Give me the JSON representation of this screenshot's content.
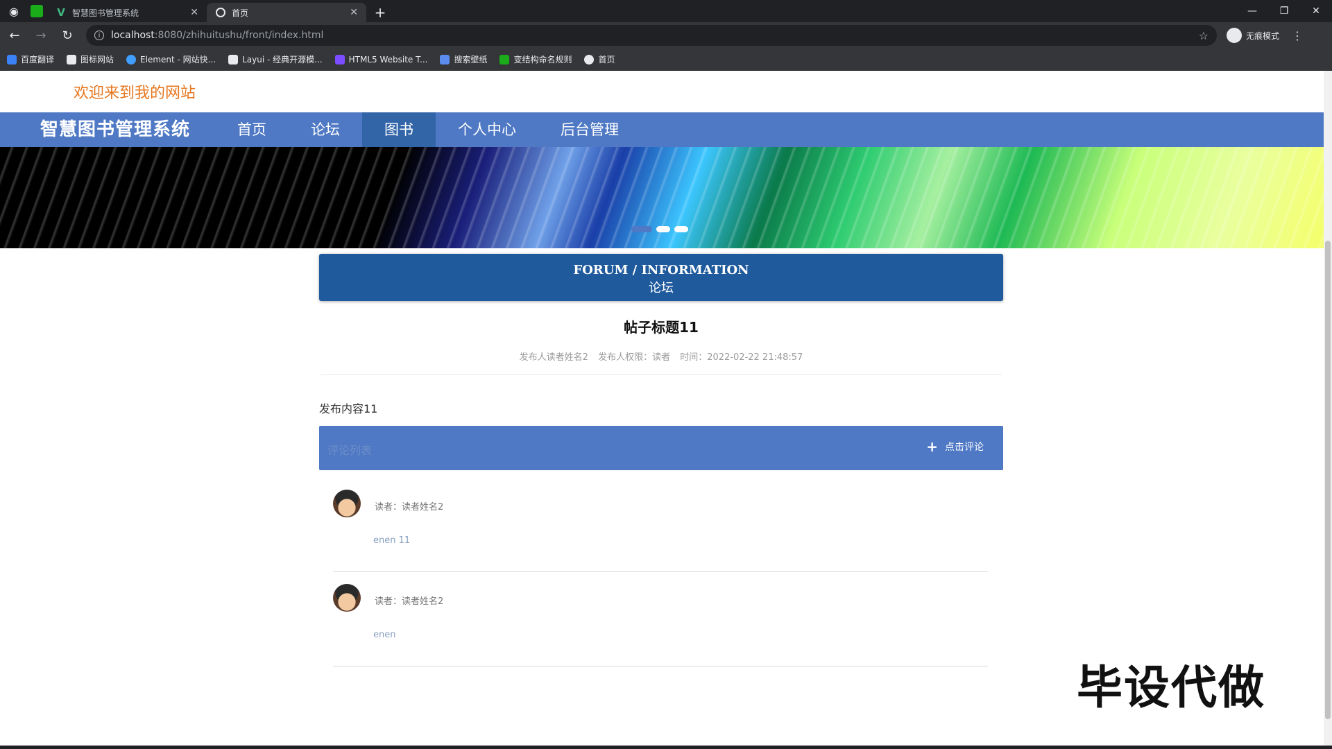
{
  "browser": {
    "tabs": [
      {
        "title": "智慧图书管理系统",
        "active": false
      },
      {
        "title": "首页",
        "active": true
      }
    ],
    "url_host": "localhost",
    "url_path": ":8080/zhihuitushu/front/index.html",
    "incognito_label": "无痕模式",
    "bookmarks": [
      {
        "label": "百度翻译",
        "color": "#3b82f6"
      },
      {
        "label": "图标网站",
        "color": "#e8eaed"
      },
      {
        "label": "Element - 网站快...",
        "color": "#409eff"
      },
      {
        "label": "Layui - 经典开源模...",
        "color": "#e8eaed"
      },
      {
        "label": "HTML5 Website T...",
        "color": "#7c4dff"
      },
      {
        "label": "搜索壁纸",
        "color": "#5b8def"
      },
      {
        "label": "变结构命名规则",
        "color": "#1aad19"
      },
      {
        "label": "首页",
        "color": "#e8eaed"
      }
    ]
  },
  "site": {
    "welcome": "欢迎来到我的网站",
    "brand": "智慧图书管理系统",
    "menu": [
      "首页",
      "论坛",
      "图书",
      "个人中心",
      "后台管理"
    ],
    "active_menu_index": 2
  },
  "banner": {
    "dots": 3,
    "active_dot": 0
  },
  "forum": {
    "header_en": "FORUM / INFORMATION",
    "header_zh": "论坛",
    "post_title": "帖子标题11",
    "meta_poster": "发布人读者姓名2",
    "meta_role": "发布人权限：读者",
    "meta_time": "时间：2022-02-22 21:48:57",
    "content": "发布内容11",
    "comment_label": "评论列表",
    "comment_button": "点击评论",
    "comments": [
      {
        "author": "读者：读者姓名2",
        "text": "enen 11"
      },
      {
        "author": "读者：读者姓名2",
        "text": "enen"
      }
    ]
  },
  "watermark": "毕设代做",
  "colors": {
    "nav": "#4f79c4",
    "nav_active": "#3264a8",
    "forum_header": "#1f5a9c",
    "welcome": "#e6761e"
  }
}
